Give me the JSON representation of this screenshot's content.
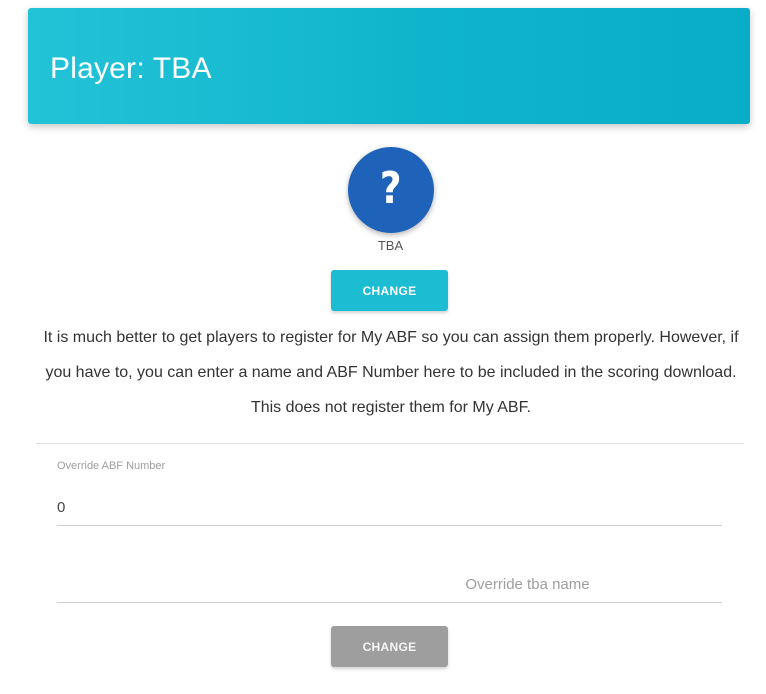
{
  "header": {
    "title": "Player: TBA"
  },
  "avatar": {
    "icon": "question-mark-icon",
    "glyph": "?",
    "color": "#1e63b9"
  },
  "player": {
    "name": "TBA"
  },
  "change_top": {
    "label": "CHANGE",
    "color": "#1cbcd2"
  },
  "info": {
    "text": "It is much better to get players to register for My ABF so you can assign them properly. However, if you have to, you can enter a name and ABF Number here to be included in the scoring download. This does not register them for My ABF."
  },
  "override_abf": {
    "label": "Override ABF Number",
    "value": "0"
  },
  "override_name": {
    "placeholder": "Override tba name",
    "value": ""
  },
  "change_bottom": {
    "label": "CHANGE",
    "color": "#9e9e9e"
  },
  "colors": {
    "header": "#1ab9d0"
  }
}
